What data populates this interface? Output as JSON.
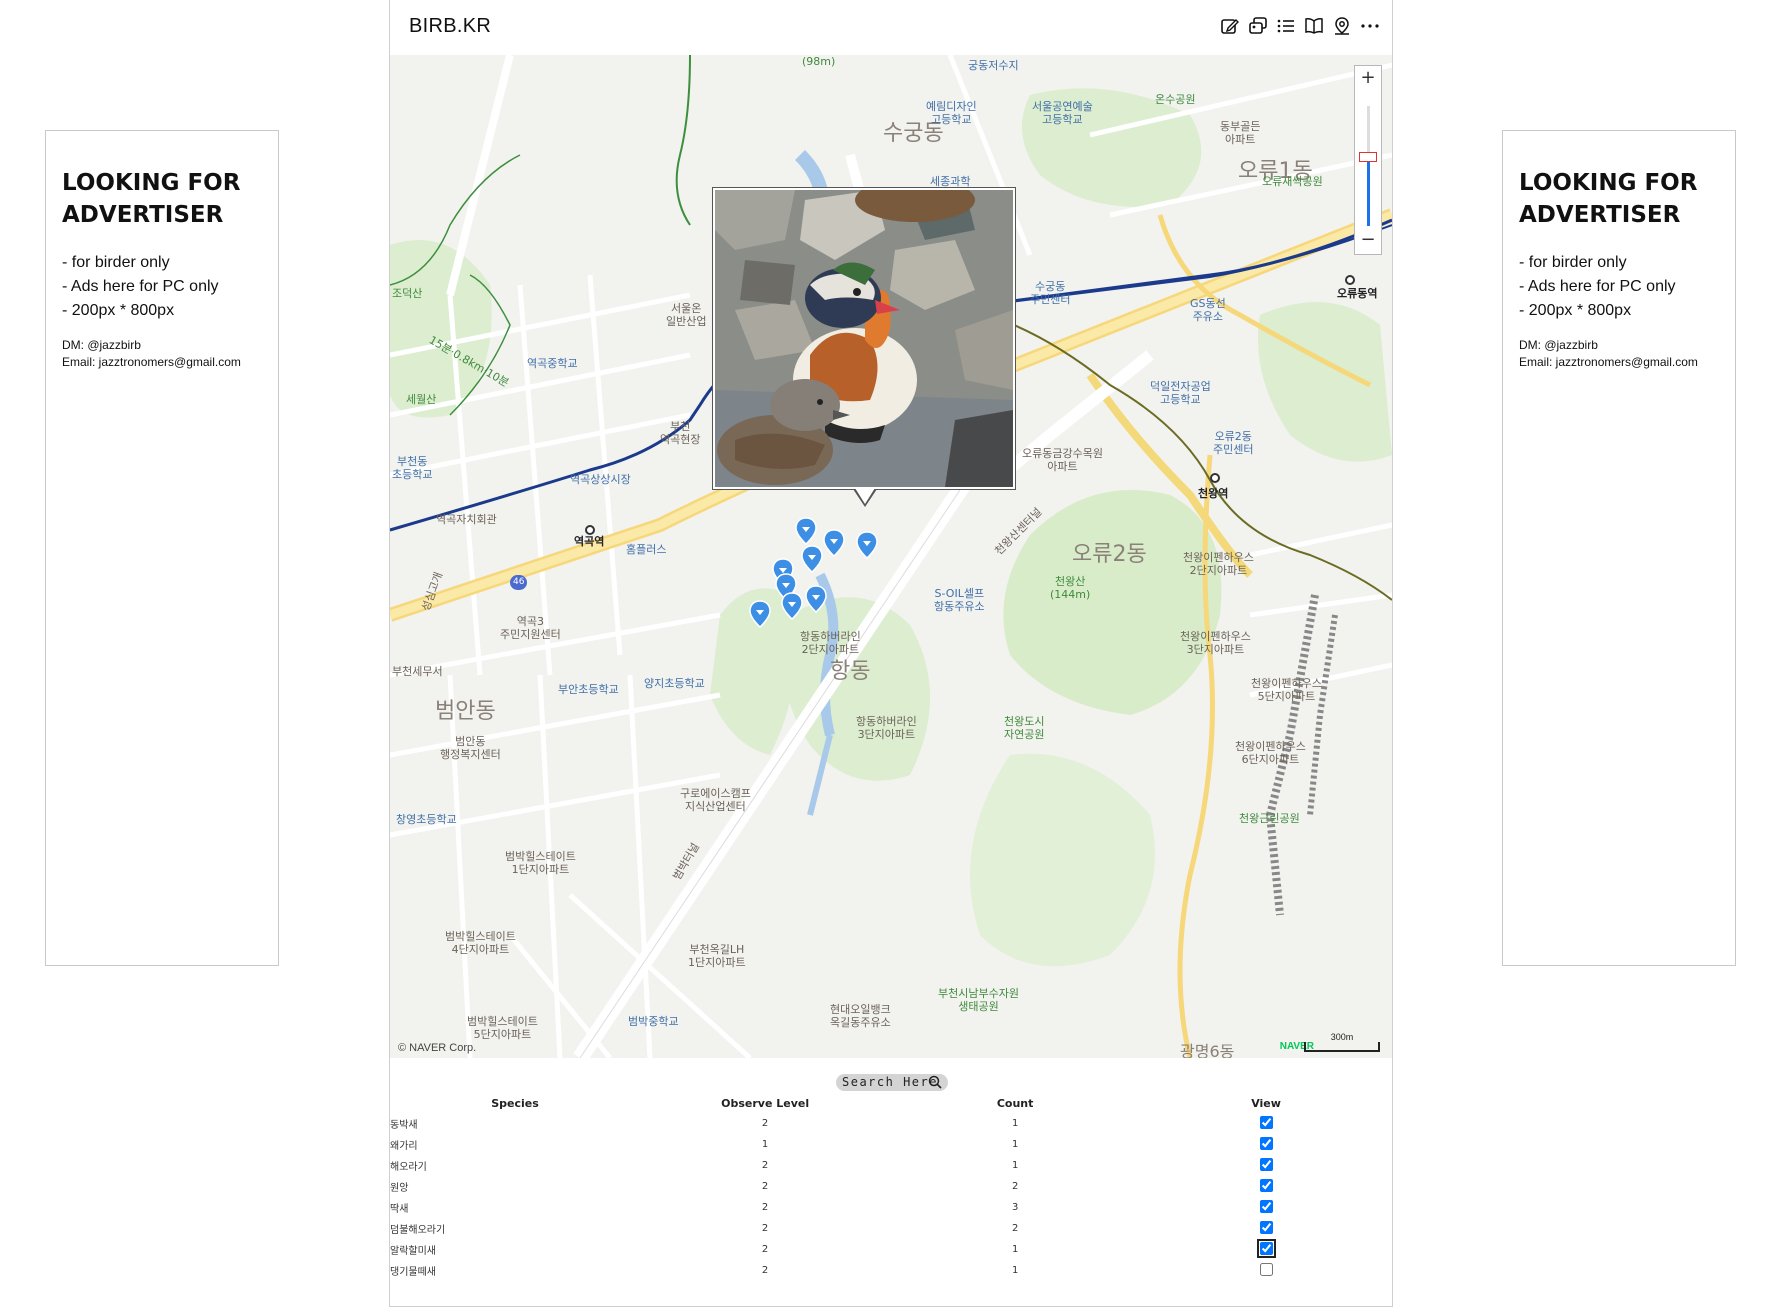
{
  "ads": {
    "left": {
      "title_line1": "LOOKING FOR",
      "title_line2": "ADVERTISER",
      "items": [
        "- for birder only",
        "- Ads here for PC only",
        "- 200px * 800px"
      ],
      "dm": "DM: @jazzbirb",
      "email": "Email: jazztronomers@gmail.com"
    },
    "right": {
      "title_line1": "LOOKING FOR",
      "title_line2": "ADVERTISER",
      "items": [
        "- for birder only",
        "- Ads here for PC only",
        "- 200px * 800px"
      ],
      "dm": "DM: @jazzbirb",
      "email": "Email: jazztronomers@gmail.com"
    }
  },
  "header": {
    "brand": "BIRB.KR",
    "tool_icons": [
      "edit-icon",
      "gallery-icon",
      "list-icon",
      "book-icon",
      "map-pin-icon",
      "more-icon"
    ]
  },
  "map": {
    "zoom_in": "+",
    "zoom_out": "−",
    "copyright": "© NAVER Corp.",
    "provider": "NAVER",
    "scale_label": "300m",
    "labels": {
      "suGungDong": "수궁동",
      "oryu1": "오류1동",
      "oryu2": "오류2동",
      "hangdong": "항동",
      "beoman": "범안동",
      "yeokgokStation": "역곡역",
      "cheonwangStation": "천왕역",
      "oryuStation": "오류동역",
      "cheonwangsan": "천왕산\n(144m)",
      "hangdongHiverline2": "항동하버라인\n2단지아파트",
      "hangdongHiverline3": "항동하버라인\n3단지아파트",
      "seoulArts": "서울공연예술\n고등학교",
      "design": "예림디자인\n고등학교",
      "yeokgokMiddle": "역곡중학교",
      "yeokgokMarket": "역곡상상시장",
      "bucheonTax": "부천세무서",
      "beomanOffice": "범안동\n행정복지센터",
      "changyeong": "창영초등학교",
      "jiyangSchool": "부안초등학교",
      "yangji": "양지초등학교",
      "guro": "구로에이스캠프\n지식산업센터",
      "beombak1": "범박힐스테이트\n1단지아파트",
      "beombak4": "범박힐스테이트\n4단지아파트",
      "beombak5": "범박힐스테이트\n5단지아파트",
      "beombakMiddle": "범박중학교",
      "okgil": "부천옥길LH\n1단지아파트",
      "hyundaiOil": "현대오일뱅크\n옥길동주유소",
      "cheonwangPark": "천왕도시\n자연공원",
      "bucheonForest": "부천시남부수자원\n생태공원",
      "soil": "S-OIL셀프\n항동주유소",
      "gyeongsin": "오류동금강수목원\n아파트",
      "deogil": "덕일전자공업\n고등학교",
      "oryu2Center": "오류2동\n주민센터",
      "ipen2": "천왕이펜하우스\n2단지아파트",
      "ipen3": "천왕이펜하우스\n3단지아파트",
      "ipen5": "천왕이펜하우스\n5단지아파트",
      "ipen6": "천왕이펜하우스\n6단지아파트",
      "cheonwangGeun": "천왕근린공원",
      "onsu": "온수공원",
      "dongbu": "동부골든\n아파트",
      "oryuPark": "오류새싹공원",
      "gs": "GS동선\n주유소",
      "sugungCenter": "수궁동\n주민센터",
      "seoulIl": "서울온\n일반산업",
      "bucheonStation": "부천\n역곡현장",
      "yeokgok3": "역곡3\n주민지원센터",
      "bucheonElem": "부천동\n초등학교",
      "jachi": "역곡자치회관",
      "homeplus": "홈플러스",
      "sejong": "세종과학",
      "seowangsan": "세월산",
      "jodoksan": "조덕산",
      "gungdong": "궁동저수지",
      "m98": "(98m)",
      "hangdongRoad": "천왕산센터널",
      "beombakRoad": "범박터널",
      "ilo": "15분·0.8km·10분",
      "gwangmyeong": "광명6동",
      "seonggo": "성심고개",
      "road46": "46"
    }
  },
  "search": {
    "placeholder": "Search Here"
  },
  "table": {
    "headers": {
      "species": "Species",
      "observe_level": "Observe Level",
      "count": "Count",
      "view": "View"
    },
    "rows": [
      {
        "species": "동박새",
        "level": "2",
        "count": "1",
        "view": true
      },
      {
        "species": "왜가리",
        "level": "1",
        "count": "1",
        "view": true
      },
      {
        "species": "해오라기",
        "level": "2",
        "count": "1",
        "view": true
      },
      {
        "species": "원앙",
        "level": "2",
        "count": "2",
        "view": true
      },
      {
        "species": "딱새",
        "level": "2",
        "count": "3",
        "view": true
      },
      {
        "species": "덤불해오라기",
        "level": "2",
        "count": "2",
        "view": true
      },
      {
        "species": "알락할미새",
        "level": "2",
        "count": "1",
        "view": true
      },
      {
        "species": "댕기물떼새",
        "level": "2",
        "count": "1",
        "view": false
      }
    ]
  },
  "colors": {
    "accent": "#1c73e8",
    "pin": "#3d8fe6",
    "rail": "#1b3a8c",
    "road_yellow": "#f7e08a",
    "park": "#d8eccb"
  }
}
